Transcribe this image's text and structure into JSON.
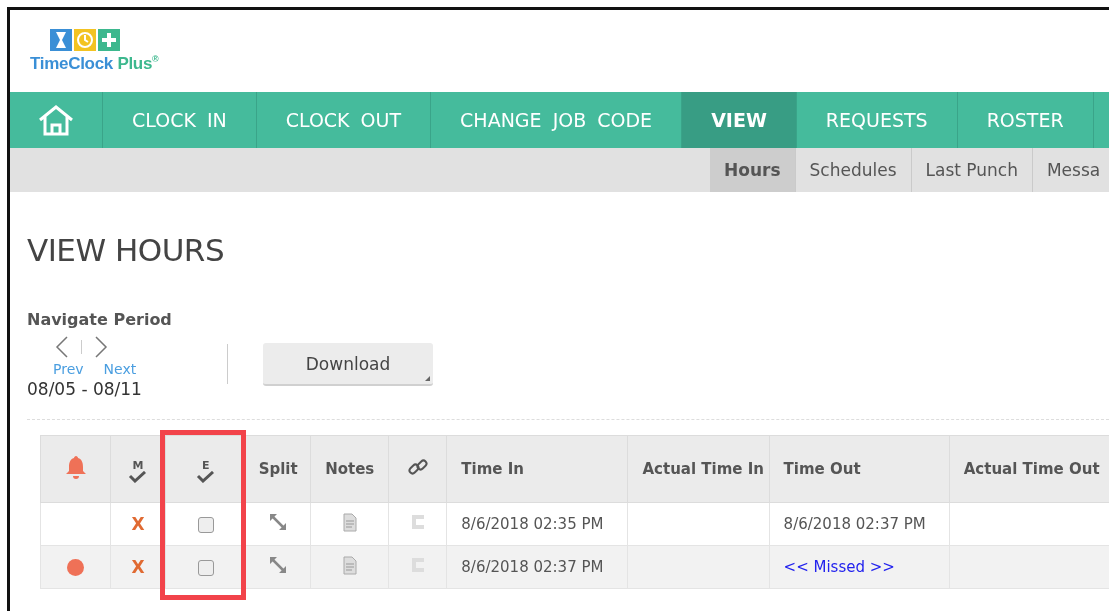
{
  "logo": {
    "brand": "TimeClock",
    "brand_plus": "Plus$^{®}$"
  },
  "nav": [
    {
      "kind": "home",
      "selected": false
    },
    {
      "kind": "text",
      "label": "CLOCK IN",
      "selected": false
    },
    {
      "kind": "text",
      "label": "CLOCK OUT",
      "selected": false
    },
    {
      "kind": "text",
      "label": "CHANGE JOB CODE",
      "selected": false
    },
    {
      "kind": "text",
      "label": "VIEW",
      "selected": true
    },
    {
      "kind": "text",
      "label": "REQUESTS",
      "selected": false
    },
    {
      "kind": "text",
      "label": "ROSTER",
      "selected": false
    }
  ],
  "subnav": [
    {
      "label": "Hours",
      "selected": true
    },
    {
      "label": "Schedules",
      "selected": false
    },
    {
      "label": "Last Punch",
      "selected": false
    },
    {
      "label": "Messa",
      "selected": false
    }
  ],
  "page_title": "VIEW HOURS",
  "period": {
    "label": "Navigate Period",
    "prev": "Prev",
    "next": "Next",
    "range": "08/05 - 08/11"
  },
  "download_button": "Download",
  "table": {
    "columns": [
      {
        "kind": "bell"
      },
      {
        "kind": "check",
        "label": "M"
      },
      {
        "kind": "check",
        "label": "E"
      },
      {
        "kind": "text",
        "label": "Split"
      },
      {
        "kind": "text",
        "label": "Notes"
      },
      {
        "kind": "link"
      },
      {
        "kind": "text",
        "label": "Time In"
      },
      {
        "kind": "text",
        "label": "Actual Time In"
      },
      {
        "kind": "text",
        "label": "Time Out"
      },
      {
        "kind": "text",
        "label": "Actual Time Out"
      }
    ],
    "rows": [
      {
        "alert": false,
        "manager_mark": "X",
        "employee_approved": false,
        "time_in": "8/6/2018 02:35 PM",
        "time_out": {
          "kind": "plain",
          "text": "8/6/2018 02:37 PM"
        }
      },
      {
        "alert": true,
        "manager_mark": "X",
        "employee_approved": false,
        "time_in": "8/6/2018 02:37 PM",
        "time_out": {
          "kind": "link",
          "text": "<< Missed >>"
        }
      }
    ]
  }
}
